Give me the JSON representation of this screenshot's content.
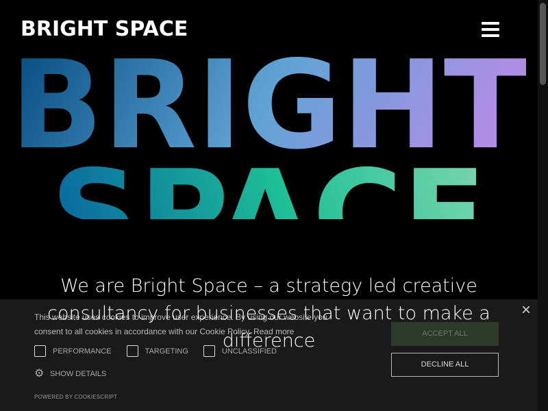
{
  "header": {
    "logo_text": "BRIGHT SPACE",
    "menu_icon": "hamburger-menu-icon"
  },
  "hero": {
    "line1": "BRIGHT",
    "line2": "SPACE",
    "colors": {
      "line1_start": "#014a7e",
      "line1_mid": "#5fa3d4",
      "line1_end": "#b08ee6",
      "line2_start": "#0b6ea0",
      "line2_mid": "#1ec096",
      "line2_end": "#7fd6b0"
    }
  },
  "tagline": "We are Bright Space – a strategy led creative consultancy for businesses that want to make a difference",
  "cookie_banner": {
    "text": "This website uses cookies to improve user experience. By using our website you consent to all cookies in accordance with our Cookie Policy. Read more",
    "close_icon": "close-icon",
    "checkboxes": [
      {
        "label": "PERFORMANCE",
        "checked": false
      },
      {
        "label": "TARGETING",
        "checked": false
      },
      {
        "label": "UNCLASSIFIED",
        "checked": false
      }
    ],
    "show_details": "SHOW DETAILS",
    "show_details_icon": "gear-icon",
    "powered_by": "POWERED BY COOKIESCRIPT",
    "accept_label": "ACCEPT ALL",
    "decline_label": "DECLINE ALL",
    "accept_color": "#2c3a2c"
  }
}
